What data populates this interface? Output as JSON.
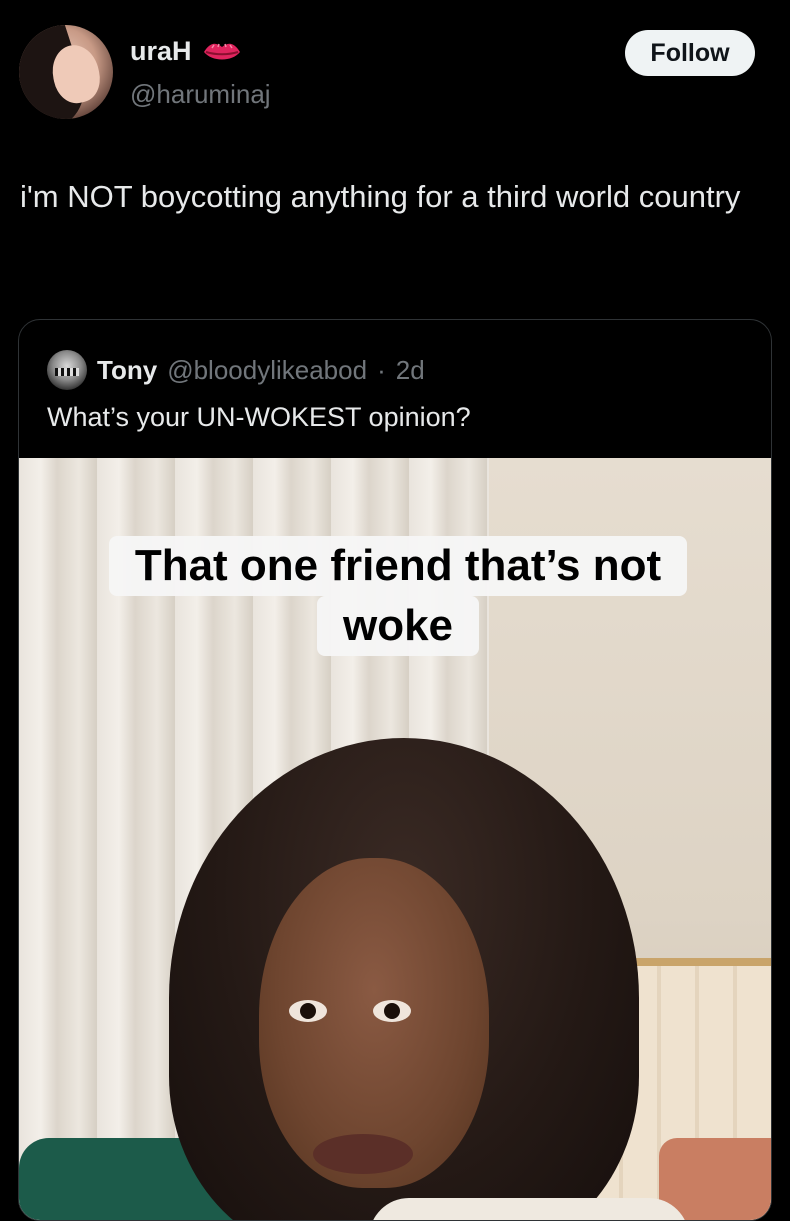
{
  "tweet": {
    "display_name": "uraH",
    "name_badge": "lips-emoji",
    "handle": "@haruminaj",
    "follow_label": "Follow",
    "text": "i'm NOT boycotting anything for a third world country"
  },
  "quote": {
    "name": "Tony",
    "handle": "@bloodylikeabod",
    "dot": "·",
    "time": "2d",
    "text": "What’s your UN-WOKEST opinion?",
    "media": {
      "caption_line1": "That one friend that’s not",
      "caption_line2": "woke"
    }
  },
  "colors": {
    "background": "#000000",
    "primary_text": "#e7e9ea",
    "secondary_text": "#71767b",
    "follow_bg": "#eff3f4",
    "follow_text": "#0f1419",
    "border": "#2f3336"
  }
}
